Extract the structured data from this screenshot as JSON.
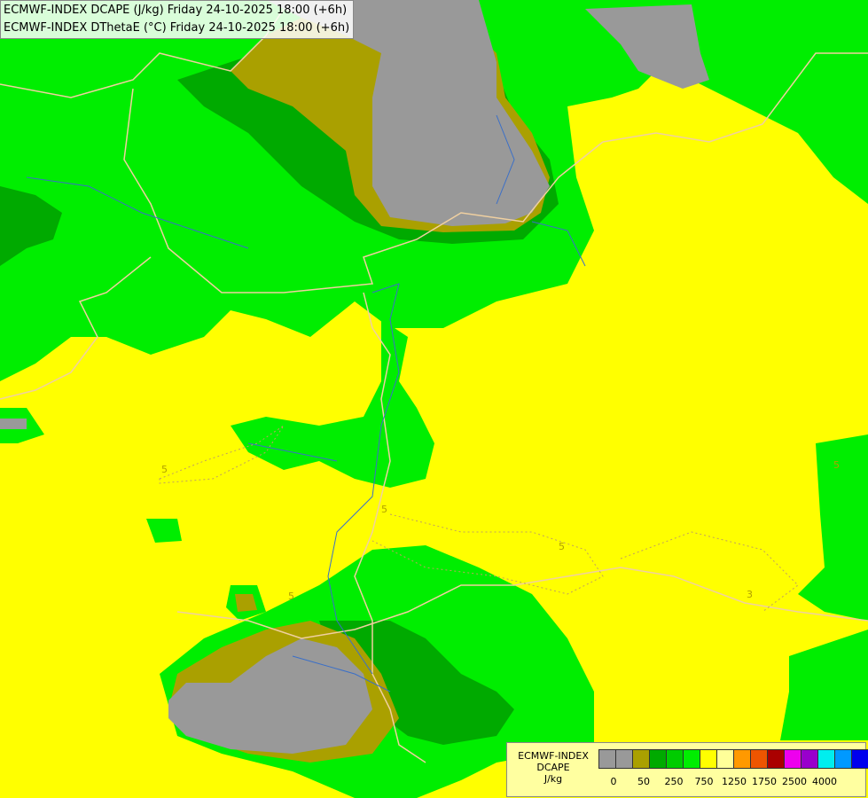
{
  "header": {
    "line1": "ECMWF-INDEX DCAPE (J/kg) Friday 24-10-2025 18:00 (+6h)",
    "line2": "ECMWF-INDEX DThetaE (°C) Friday 24-10-2025 18:00 (+6h)"
  },
  "legend": {
    "title1": "ECMWF-INDEX",
    "title2": "DCAPE",
    "units": "J/kg",
    "colors": [
      "#999999",
      "#999999",
      "#aaa000",
      "#00aa00",
      "#00cc00",
      "#00ee00",
      "#ffff00",
      "#ffff99",
      "#ff9900",
      "#ee5500",
      "#aa0000",
      "#ee00ee",
      "#9900cc",
      "#00eeee",
      "#0099ff",
      "#0000ee",
      "#000099"
    ],
    "ticks": [
      "0",
      "50",
      "250",
      "750",
      "1250",
      "1750",
      "2500",
      "4000"
    ]
  },
  "contour_labels": [
    "5",
    "5",
    "5",
    "5",
    "3",
    "5"
  ],
  "colors": {
    "yellow": "#ffff00",
    "bright_green": "#00ee00",
    "mid_green": "#00cc00",
    "dark_green": "#00aa00",
    "olive": "#aaa000",
    "gray": "#999999",
    "pale_green": "#99ff99"
  }
}
